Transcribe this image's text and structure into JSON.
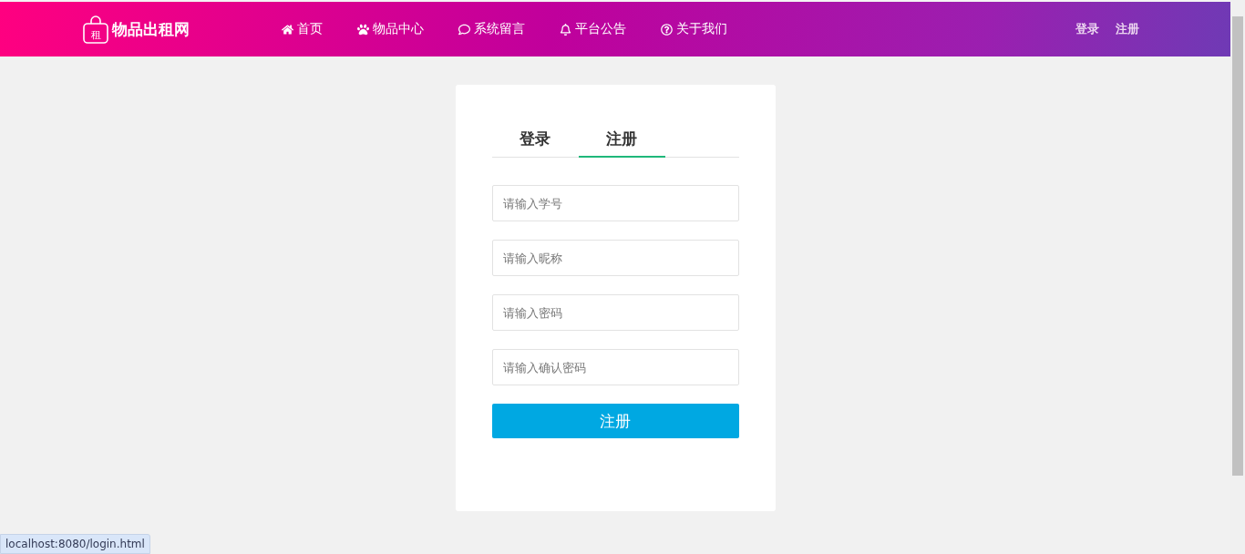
{
  "header": {
    "logo": {
      "badge": "租",
      "title": "物品出租网"
    },
    "nav": [
      {
        "kind": "home",
        "label": "首页"
      },
      {
        "kind": "paw",
        "label": "物品中心"
      },
      {
        "kind": "comment",
        "label": "系统留言"
      },
      {
        "kind": "bell",
        "label": "平台公告"
      },
      {
        "kind": "question",
        "label": "关于我们"
      }
    ],
    "account_links": [
      "登录",
      "注册"
    ]
  },
  "form": {
    "tabs": [
      {
        "label": "登录",
        "selected": false
      },
      {
        "label": "注册",
        "selected": true
      }
    ],
    "fields": [
      {
        "placeholder": "请输入学号"
      },
      {
        "placeholder": "请输入昵称"
      },
      {
        "placeholder": "请输入密码"
      },
      {
        "placeholder": "请输入确认密码"
      }
    ],
    "submit": "注册"
  },
  "status_bar": {
    "url": "localhost:8080/login.html"
  }
}
